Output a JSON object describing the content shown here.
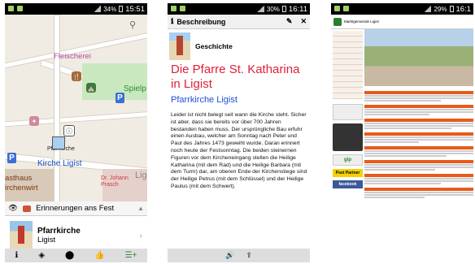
{
  "phone1": {
    "status_time": "15:51",
    "battery": "34%",
    "map_labels": [
      "Fleischerei",
      "Spielp",
      "Pfarrkirche",
      "Kirche Ligist",
      "asthaus",
      "irchenwirt",
      "Dr. Johann",
      "Prasch",
      "Lig",
      "P",
      "P"
    ],
    "header_text": "Erinnerungen ans Fest",
    "card_title": "Pfarrkirche",
    "card_subtitle": "Ligist"
  },
  "phone2": {
    "status_time": "16:11",
    "battery": "30%",
    "header_title": "Beschreibung",
    "section": "Geschichte",
    "title": "Die Pfarre St. Katharina in Ligist",
    "subtitle": "Pfarrkirche Ligist",
    "body": "Leider ist nicht belegt seit wann die Kirche steht. Sicher ist aber, dass sie bereits vor über 700 Jahren bestanden haben muss. Der ursprüngliche Bau erfuhr einen Ausbau, welcher am Sonntag nach Peter und Paul des Jahres 1473 geweiht wurde. Daran erinnert noch heute der Festsonntag. Die beiden steinernen Figuren vor dem Kircheneingang stellen die Heilige Katharina (mit dem Rad) und die Heilige Barbara (mit dem Turm) dar, am oberen Ende der Kirchenstiege sind der Heilige Petrus (mit dem Schlüssel) und der Heilige Paulus (mit dem Schwert)."
  },
  "phone3": {
    "status_time": "16:1",
    "battery": "29%",
    "site_name": "Marktgemeinde Ligist",
    "side_labels": [
      "gip",
      "Post Partner",
      "facebook"
    ]
  },
  "colors": {
    "red_title": "#e0203a",
    "blue_subtitle": "#1f4fd8",
    "orange_bar": "#e85a1a"
  }
}
